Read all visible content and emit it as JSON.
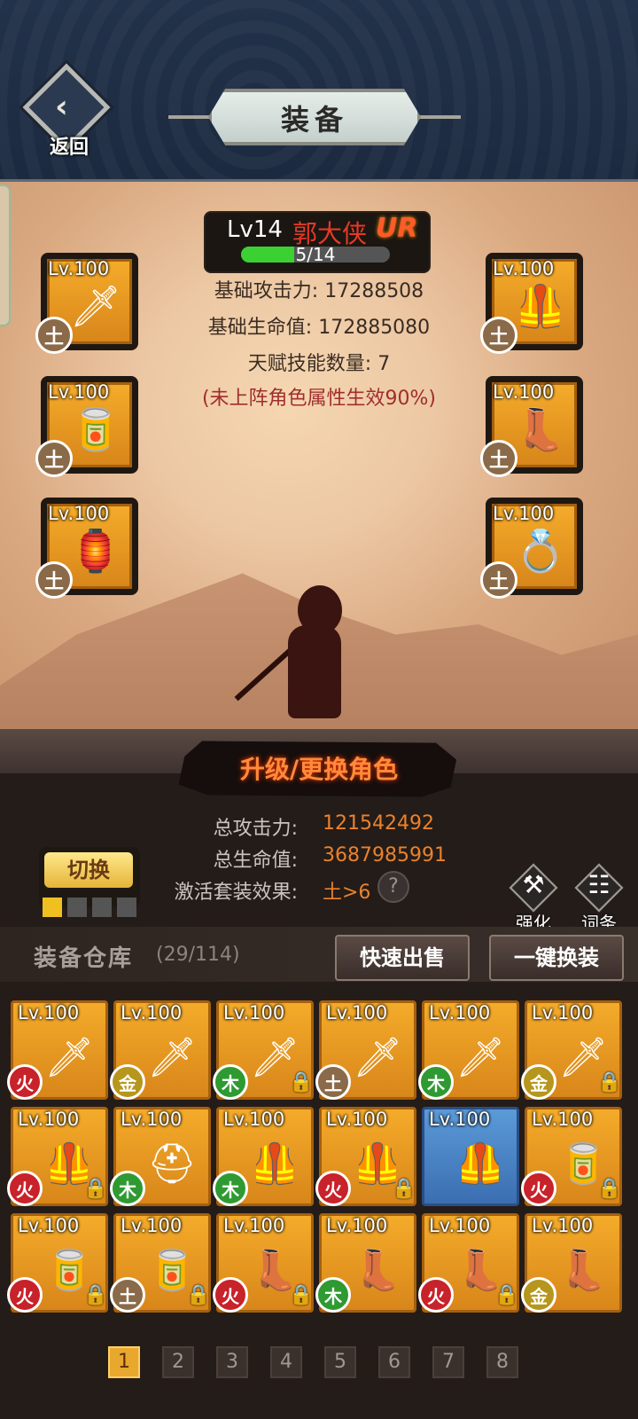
{
  "header": {
    "back_label": "返回",
    "title": "装备"
  },
  "hero": {
    "level": "Lv14",
    "name": "郭大侠",
    "rank": "UR",
    "progress_text": "5/14",
    "progress": 0.357,
    "stats": [
      "基础攻击力: 17288508",
      "基础生命值: 172885080",
      "天赋技能数量: 7"
    ],
    "note": "(未上阵角色属性生效90%)"
  },
  "equipped": [
    {
      "level": "Lv.100",
      "element": "土",
      "icon": "sword-icon"
    },
    {
      "level": "Lv.100",
      "element": "土",
      "icon": "chest-armor-icon"
    },
    {
      "level": "Lv.100",
      "element": "土",
      "icon": "bracer-icon"
    },
    {
      "level": "Lv.100",
      "element": "土",
      "icon": "boots-icon"
    },
    {
      "level": "Lv.100",
      "element": "土",
      "icon": "amulet-icon"
    },
    {
      "level": "Lv.100",
      "element": "土",
      "icon": "ring-icon"
    }
  ],
  "upgrade_label": "升级/更换角色",
  "totals": [
    {
      "label": "总攻击力:",
      "value": "121542492"
    },
    {
      "label": "总生命值:",
      "value": "3687985991"
    },
    {
      "label": "激活套装效果:",
      "value": "土>6"
    }
  ],
  "help_mark": "?",
  "switch_label": "切换",
  "tools": [
    {
      "label": "强化",
      "icon": "hammer-icon",
      "glyph": "⚒"
    },
    {
      "label": "词条",
      "icon": "list-icon",
      "glyph": "☷"
    }
  ],
  "warehouse": {
    "title": "装备仓库",
    "count": "(29/114)",
    "quick_sell": "快速出售",
    "one_click_equip": "一键换装"
  },
  "items": [
    {
      "level": "Lv.100",
      "element": "火",
      "locked": false
    },
    {
      "level": "Lv.100",
      "element": "金",
      "locked": false
    },
    {
      "level": "Lv.100",
      "element": "木",
      "locked": true
    },
    {
      "level": "Lv.100",
      "element": "土",
      "locked": false
    },
    {
      "level": "Lv.100",
      "element": "木",
      "locked": false
    },
    {
      "level": "Lv.100",
      "element": "金",
      "locked": true
    },
    {
      "level": "Lv.100",
      "element": "火",
      "locked": true
    },
    {
      "level": "Lv.100",
      "element": "木",
      "locked": false
    },
    {
      "level": "Lv.100",
      "element": "木",
      "locked": false
    },
    {
      "level": "Lv.100",
      "element": "火",
      "locked": true
    },
    {
      "level": "Lv.100",
      "element": "",
      "locked": false
    },
    {
      "level": "Lv.100",
      "element": "火",
      "locked": true
    },
    {
      "level": "Lv.100",
      "element": "火",
      "locked": true
    },
    {
      "level": "Lv.100",
      "element": "土",
      "locked": true
    },
    {
      "level": "Lv.100",
      "element": "火",
      "locked": true
    },
    {
      "level": "Lv.100",
      "element": "木",
      "locked": false
    },
    {
      "level": "Lv.100",
      "element": "火",
      "locked": true
    },
    {
      "level": "Lv.100",
      "element": "金",
      "locked": false
    }
  ],
  "pages": [
    "1",
    "2",
    "3",
    "4",
    "5",
    "6",
    "7",
    "8"
  ],
  "current_page": "1"
}
